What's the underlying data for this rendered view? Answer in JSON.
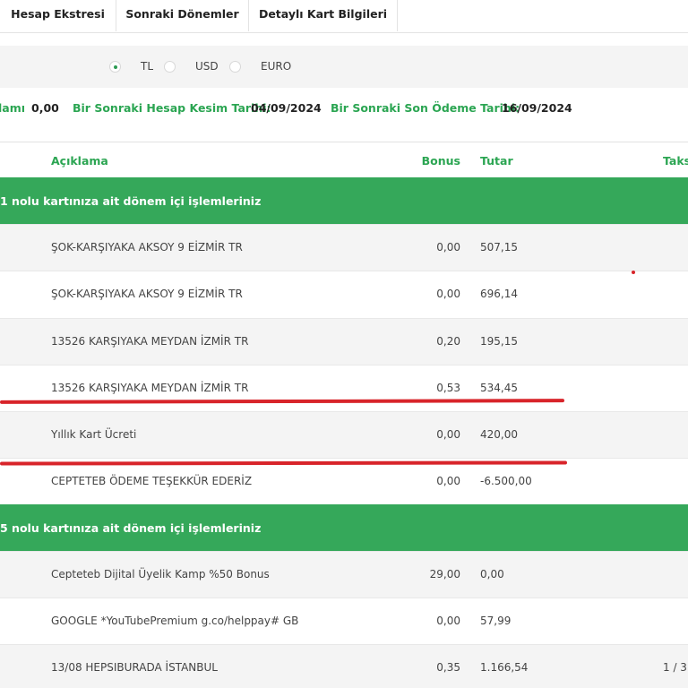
{
  "tabs": [
    "Hesap Ekstresi",
    "Sonraki Dönemler",
    "Detaylı Kart Bilgileri"
  ],
  "currency": {
    "options": [
      "TL",
      "USD",
      "EURO"
    ],
    "selected": "TL"
  },
  "summary": {
    "partial_label": "lamı",
    "partial_value": "0,00",
    "next_statement_label": "Bir Sonraki Hesap Kesim Tarihi:",
    "next_statement_value": "04/09/2024",
    "next_due_label": "Bir Sonraki Son Ödeme Tarihi:",
    "next_due_value": "16/09/2024"
  },
  "table": {
    "headers": {
      "description": "Açıklama",
      "bonus": "Bonus",
      "amount": "Tutar",
      "installment": "Taks"
    },
    "sections": [
      {
        "title": "1 nolu kartınıza ait dönem içi işlemleriniz",
        "rows": [
          {
            "description": "ŞOK-KARŞIYAKA AKSOY 9 EİZMİR TR",
            "bonus": "0,00",
            "amount": "507,15",
            "installment": ""
          },
          {
            "description": "ŞOK-KARŞIYAKA AKSOY 9 EİZMİR TR",
            "bonus": "0,00",
            "amount": "696,14",
            "installment": ""
          },
          {
            "description": "13526 KARŞIYAKA MEYDAN İZMİR TR",
            "bonus": "0,20",
            "amount": "195,15",
            "installment": ""
          },
          {
            "description": "13526 KARŞIYAKA MEYDAN İZMİR TR",
            "bonus": "0,53",
            "amount": "534,45",
            "installment": ""
          },
          {
            "description": "Yıllık Kart Ücreti",
            "bonus": "0,00",
            "amount": "420,00",
            "installment": ""
          },
          {
            "description": "CEPTETEB ÖDEME TEŞEKKÜR EDERİZ",
            "bonus": "0,00",
            "amount": "-6.500,00",
            "installment": ""
          }
        ]
      },
      {
        "title": "5 nolu kartınıza ait dönem içi işlemleriniz",
        "rows": [
          {
            "description": "Cepteteb Dijital Üyelik Kamp %50 Bonus",
            "bonus": "29,00",
            "amount": "0,00",
            "installment": ""
          },
          {
            "description": "GOOGLE *YouTubePremium g.co/helppay# GB",
            "bonus": "0,00",
            "amount": "57,99",
            "installment": ""
          },
          {
            "description": "13/08 HEPSIBURADA İSTANBUL",
            "bonus": "0,35",
            "amount": "1.166,54",
            "installment": "1 / 3"
          }
        ]
      }
    ]
  },
  "colors": {
    "accent_green": "#2ba552",
    "section_green": "#35a85a",
    "annotation_red": "#d8242a"
  }
}
